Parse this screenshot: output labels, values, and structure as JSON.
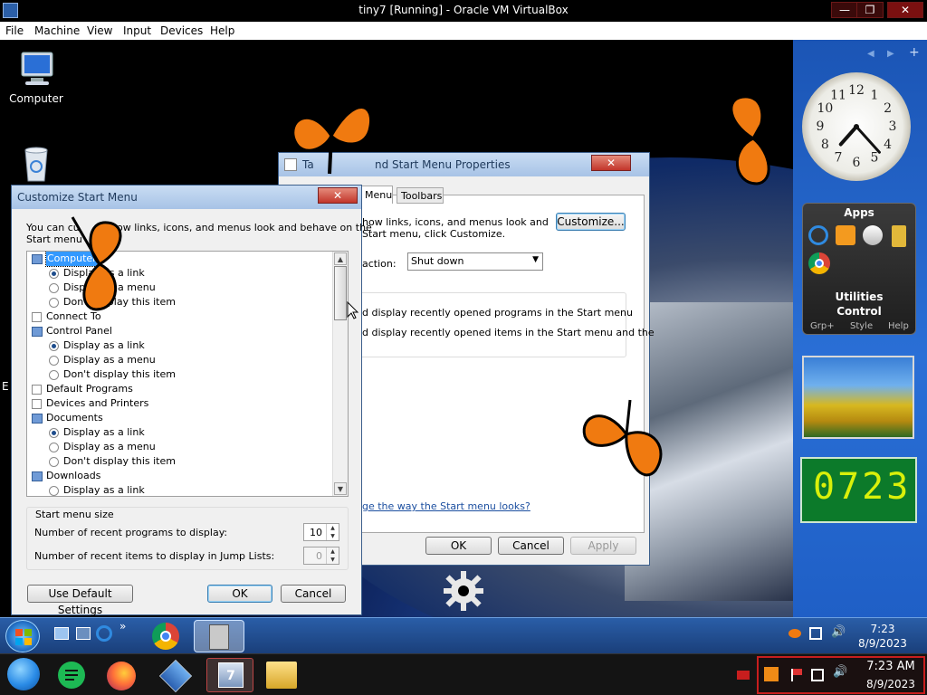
{
  "host_window": {
    "title": "tiny7 [Running] - Oracle VM VirtualBox",
    "controls": {
      "minimize": "—",
      "maximize": "❐",
      "close": "✕"
    },
    "menu": [
      "File",
      "Machine",
      "View",
      "Input",
      "Devices",
      "Help"
    ]
  },
  "desktop": {
    "icons": [
      {
        "label": "Computer"
      }
    ]
  },
  "taskbar_props": {
    "title": "Taskbar and Start Menu Properties",
    "title_visible": "Ta",
    "title_visible_2": "nd Start Menu Properties",
    "tabs": [
      "Menu",
      "Toolbars"
    ],
    "desc_line1": "how links, icons, and menus look and",
    "desc_line2": "Start menu, click Customize.",
    "customize_label": "Customize...",
    "power_label": "action:",
    "power_value": "Shut down",
    "privacy1": "d display recently opened programs in the Start menu",
    "privacy2": "d display recently opened items in the Start menu and the",
    "link": "ge the way the Start menu looks?",
    "ok": "OK",
    "cancel": "Cancel",
    "apply": "Apply"
  },
  "customize": {
    "title": "Customize Start Menu",
    "close": "✕",
    "desc_a": "You can cu",
    "desc_b": "se how links, icons, and menus look and behave on the",
    "desc_c": "Start menu",
    "tree": [
      {
        "type": "item",
        "label": "Computer",
        "selected": true
      },
      {
        "type": "radio",
        "label": "Display as a link",
        "checked": true,
        "partial": "Displa",
        "partial2": "k"
      },
      {
        "type": "radio",
        "label": "Display as a menu",
        "checked": false,
        "partial": "Dis",
        "partial2": "enu"
      },
      {
        "type": "radio",
        "label": "Don't display this item",
        "checked": false,
        "partial": "D",
        "partial2": "display this item"
      },
      {
        "type": "check",
        "label": "Connect To",
        "checked": false
      },
      {
        "type": "item",
        "label": "Control Panel"
      },
      {
        "type": "radio",
        "label": "Display as a link",
        "checked": true
      },
      {
        "type": "radio",
        "label": "Display as a menu",
        "checked": false
      },
      {
        "type": "radio",
        "label": "Don't display this item",
        "checked": false
      },
      {
        "type": "check",
        "label": "Default Programs",
        "checked": false
      },
      {
        "type": "check",
        "label": "Devices and Printers",
        "checked": false
      },
      {
        "type": "item",
        "label": "Documents"
      },
      {
        "type": "radio",
        "label": "Display as a link",
        "checked": true
      },
      {
        "type": "radio",
        "label": "Display as a menu",
        "checked": false
      },
      {
        "type": "radio",
        "label": "Don't display this item",
        "checked": false
      },
      {
        "type": "item",
        "label": "Downloads"
      },
      {
        "type": "radio",
        "label": "Display as a link",
        "checked": false
      }
    ],
    "size_group": "Start menu size",
    "recent_programs_label": "Number of recent programs to display:",
    "recent_programs_value": "10",
    "recent_items_label": "Number of recent items to display in Jump Lists:",
    "recent_items_value": "0",
    "use_default": "Use Default Settings",
    "ok": "OK",
    "cancel": "Cancel"
  },
  "sidebar": {
    "clock_numbers": [
      "12",
      "1",
      "2",
      "3",
      "4",
      "5",
      "6",
      "7",
      "8",
      "9",
      "10",
      "11"
    ],
    "clock_time": {
      "hour": 7,
      "minute": 23
    },
    "apps_title": "Apps",
    "utilities": "Utilities",
    "control": "Control",
    "footer": [
      "Grp+",
      "Style",
      "Help"
    ],
    "led_value": "0723"
  },
  "guest_taskbar": {
    "time": "7:23",
    "date": "8/9/2023",
    "quicklaunch_more": "»"
  },
  "host_taskbar": {
    "time": "7:23 AM",
    "date": "8/9/2023"
  }
}
